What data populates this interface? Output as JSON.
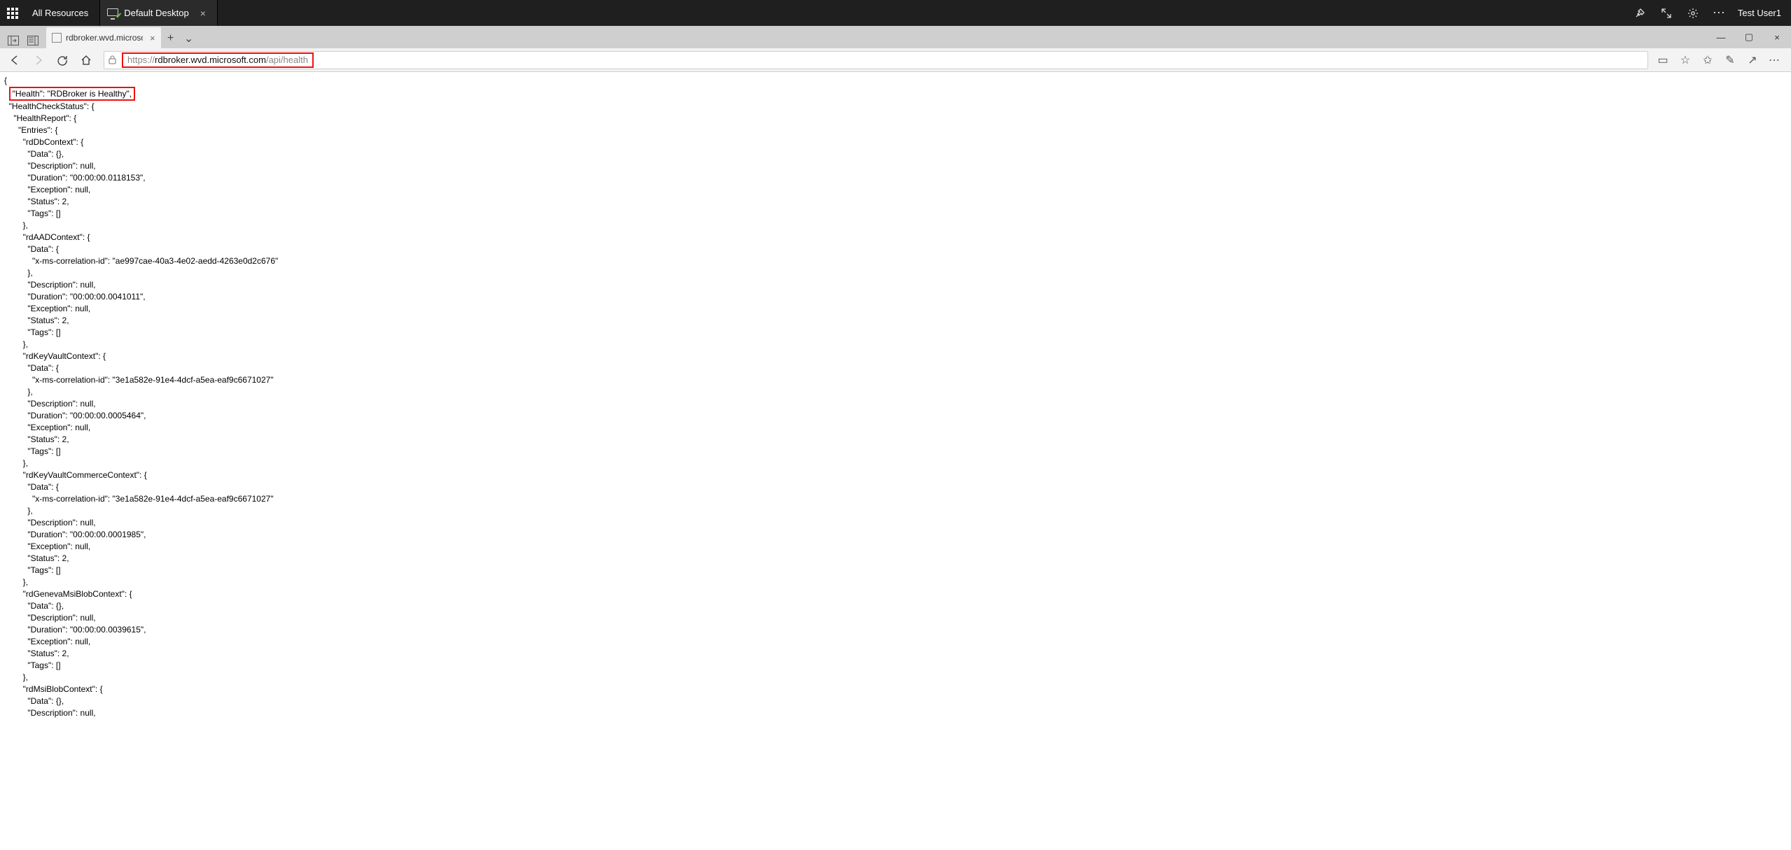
{
  "titlebar": {
    "all_resources_label": "All Resources",
    "session_tab_label": "Default Desktop",
    "user_label": "Test User1"
  },
  "browser": {
    "tab_title": "rdbroker.wvd.microsoft.",
    "url_proto": "https://",
    "url_host": "rdbroker.wvd.microsoft.com",
    "url_path": "/api/health",
    "full_url": "https://rdbroker.wvd.microsoft.com/api/health"
  },
  "glyphs": {
    "plus": "+",
    "x": "×",
    "chev_down": "⌄",
    "lock": "🔒",
    "star_o": "☆",
    "star2": "✩",
    "pencil": "✎",
    "share": "↗",
    "ellipsis": "⋯",
    "gear": "⚙",
    "expand": "⤢",
    "pin": "📌",
    "min": "—",
    "max": "▢",
    "reading": "▭"
  },
  "health_json": {
    "highlighted_line": "\"Health\": \"RDBroker is Healthy\",",
    "before": "{\n  ",
    "after": "\n  \"HealthCheckStatus\": {\n    \"HealthReport\": {\n      \"Entries\": {\n        \"rdDbContext\": {\n          \"Data\": {},\n          \"Description\": null,\n          \"Duration\": \"00:00:00.0118153\",\n          \"Exception\": null,\n          \"Status\": 2,\n          \"Tags\": []\n        },\n        \"rdAADContext\": {\n          \"Data\": {\n            \"x-ms-correlation-id\": \"ae997cae-40a3-4e02-aedd-4263e0d2c676\"\n          },\n          \"Description\": null,\n          \"Duration\": \"00:00:00.0041011\",\n          \"Exception\": null,\n          \"Status\": 2,\n          \"Tags\": []\n        },\n        \"rdKeyVaultContext\": {\n          \"Data\": {\n            \"x-ms-correlation-id\": \"3e1a582e-91e4-4dcf-a5ea-eaf9c6671027\"\n          },\n          \"Description\": null,\n          \"Duration\": \"00:00:00.0005464\",\n          \"Exception\": null,\n          \"Status\": 2,\n          \"Tags\": []\n        },\n        \"rdKeyVaultCommerceContext\": {\n          \"Data\": {\n            \"x-ms-correlation-id\": \"3e1a582e-91e4-4dcf-a5ea-eaf9c6671027\"\n          },\n          \"Description\": null,\n          \"Duration\": \"00:00:00.0001985\",\n          \"Exception\": null,\n          \"Status\": 2,\n          \"Tags\": []\n        },\n        \"rdGenevaMsiBlobContext\": {\n          \"Data\": {},\n          \"Description\": null,\n          \"Duration\": \"00:00:00.0039615\",\n          \"Exception\": null,\n          \"Status\": 2,\n          \"Tags\": []\n        },\n        \"rdMsiBlobContext\": {\n          \"Data\": {},\n          \"Description\": null,"
  }
}
